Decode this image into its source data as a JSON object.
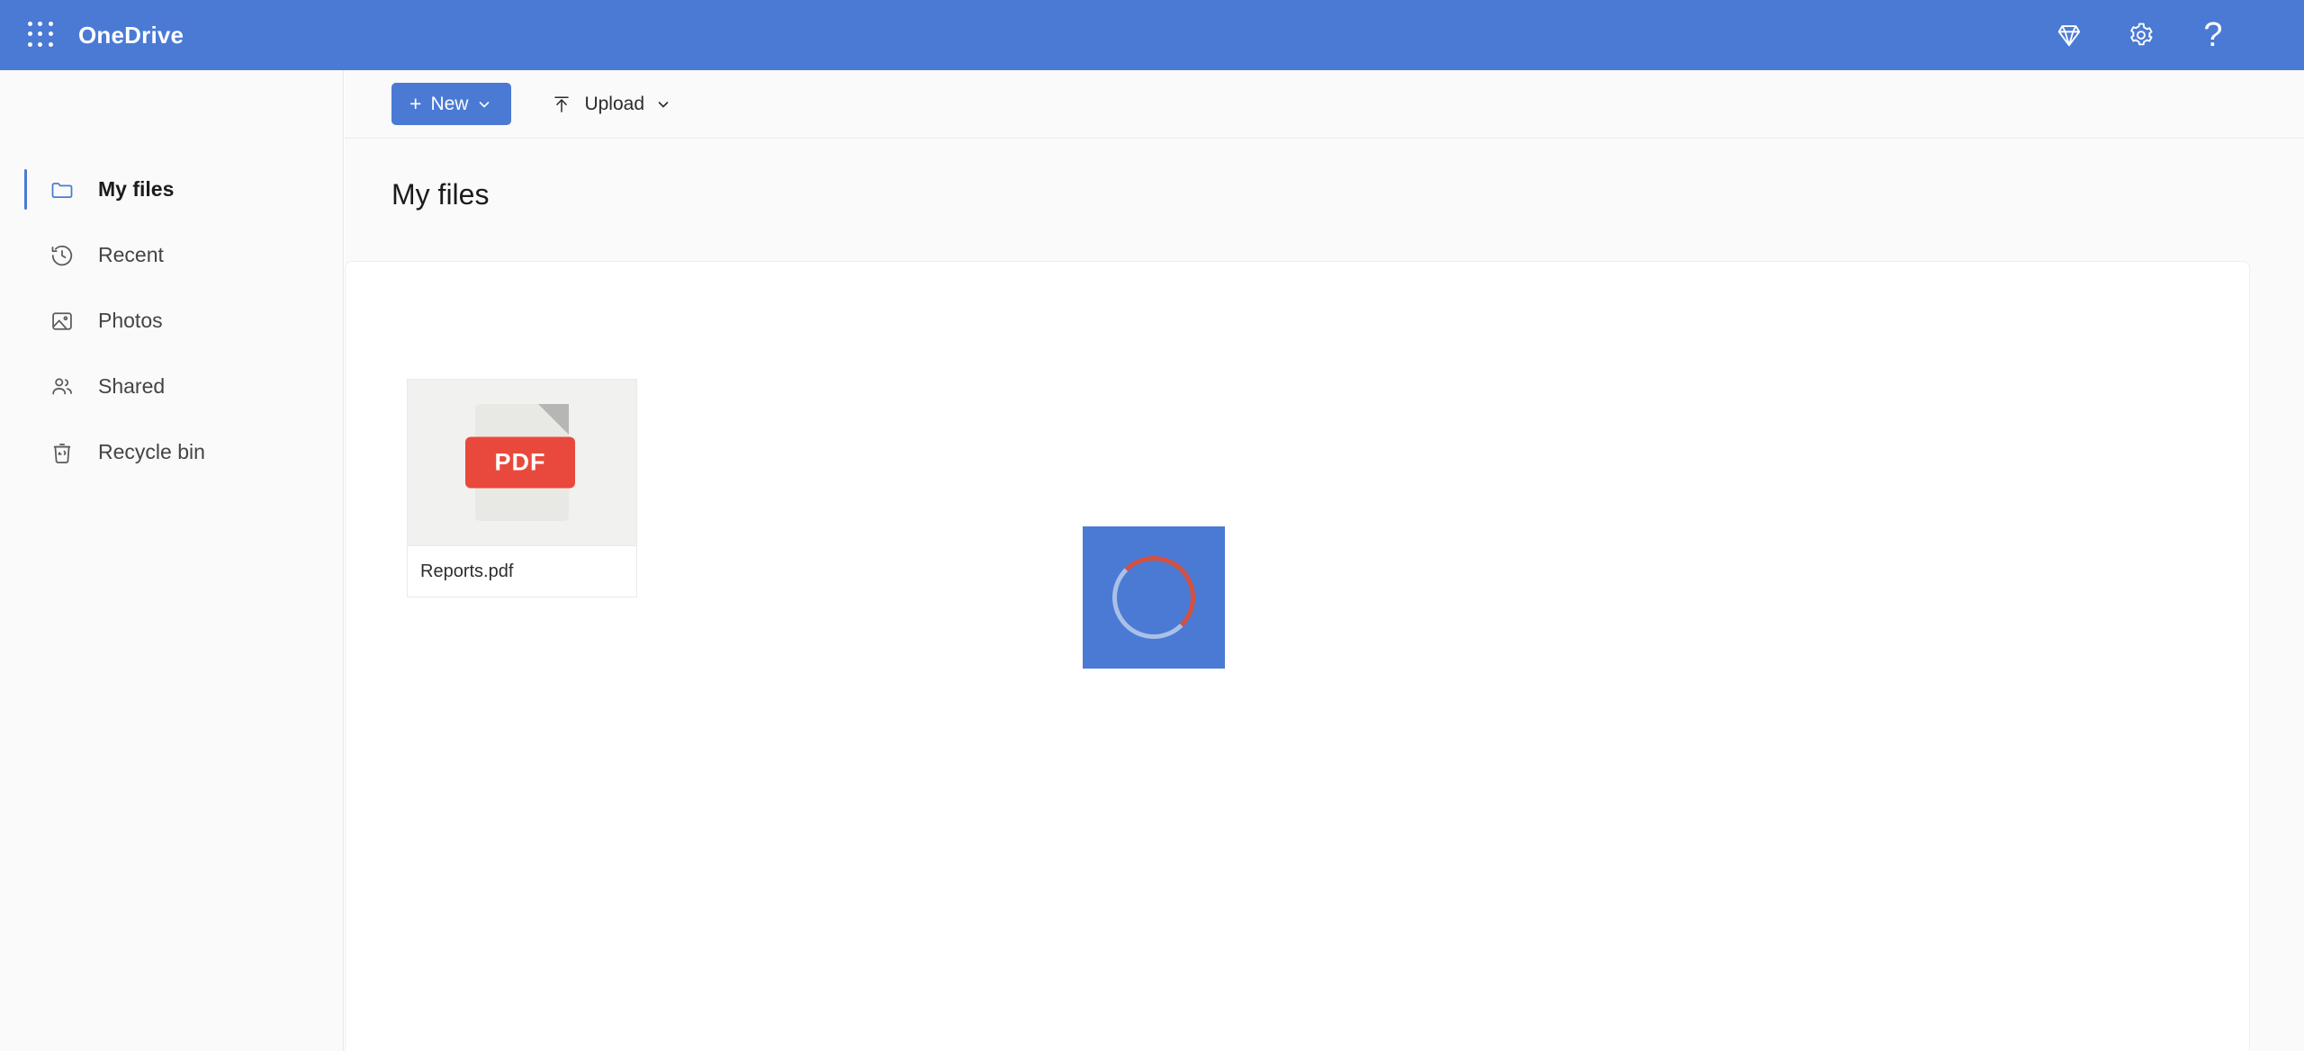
{
  "header": {
    "brand": "OneDrive",
    "waffle_icon": "app-launcher-grid-icon",
    "actions": [
      {
        "name": "premium-diamond-icon",
        "label": ""
      },
      {
        "name": "settings-gear-icon",
        "label": ""
      },
      {
        "name": "help-question-icon",
        "label": "?"
      }
    ]
  },
  "sidebar": {
    "items": [
      {
        "label": "My files",
        "icon": "folder-icon",
        "active": true
      },
      {
        "label": "Recent",
        "icon": "clock-history-icon",
        "active": false
      },
      {
        "label": "Photos",
        "icon": "photo-icon",
        "active": false
      },
      {
        "label": "Shared",
        "icon": "people-icon",
        "active": false
      },
      {
        "label": "Recycle bin",
        "icon": "recycle-bin-icon",
        "active": false
      }
    ]
  },
  "toolbar": {
    "new_label": "New",
    "new_plus": "+",
    "upload_label": "Upload"
  },
  "main": {
    "page_title": "My files"
  },
  "files": [
    {
      "name": "Reports.pdf",
      "type_badge": "PDF"
    }
  ],
  "loading": {
    "visible": true,
    "spinner_track_color": "#a9c1e8",
    "spinner_accent_color": "#d6503f",
    "box_color": "#4a7ad4"
  },
  "colors": {
    "header_blue": "#4a7ad4",
    "accent_blue": "#4a7ad4",
    "pdf_red": "#e9493c",
    "page_bg": "#fafafa",
    "panel_bg": "#ffffff"
  }
}
